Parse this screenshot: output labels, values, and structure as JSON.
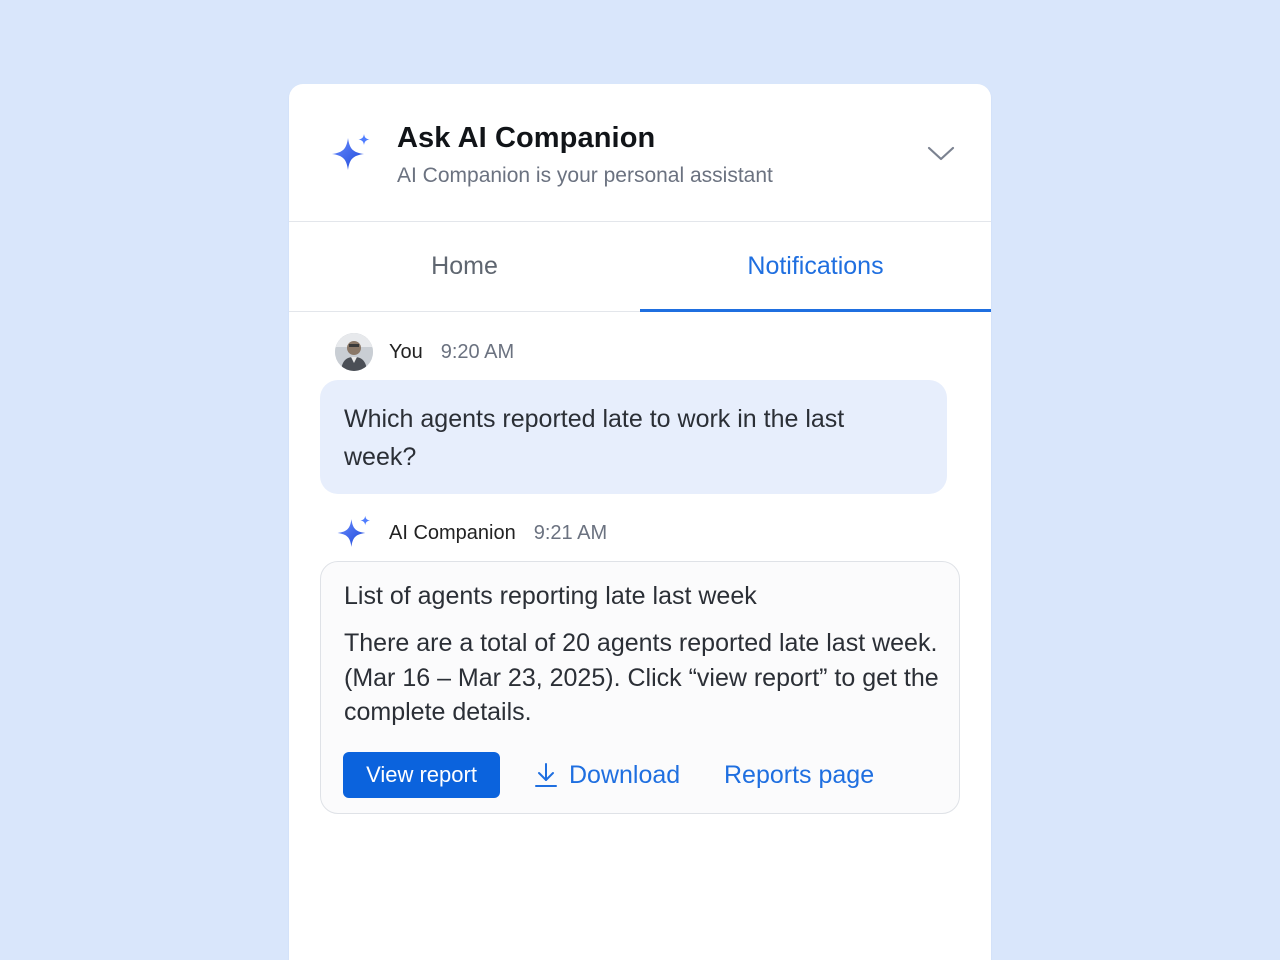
{
  "header": {
    "title": "Ask AI Companion",
    "subtitle": "AI Companion is your personal assistant",
    "logo_icon": "sparkle-icon",
    "collapse_icon": "chevron-down-icon"
  },
  "tabs": [
    {
      "label": "Home",
      "active": false
    },
    {
      "label": "Notifications",
      "active": true
    }
  ],
  "messages": {
    "user": {
      "name": "You",
      "time": "9:20 AM",
      "text": "Which agents reported late to work in the last week?"
    },
    "ai": {
      "name": "AI Companion",
      "time": "9:21 AM",
      "card_title": "List of agents reporting late last week",
      "card_body": "There are a total of 20 agents reported late last week. (Mar 16 – Mar 23, 2025). Click “view report” to get the complete details.",
      "actions": {
        "view_report": "View report",
        "download": "Download",
        "reports_page": "Reports page"
      }
    }
  },
  "colors": {
    "background": "#d9e6fb",
    "accent": "#1f6fe0",
    "primary_button": "#0b63dd",
    "user_bubble": "#e7eefc"
  }
}
